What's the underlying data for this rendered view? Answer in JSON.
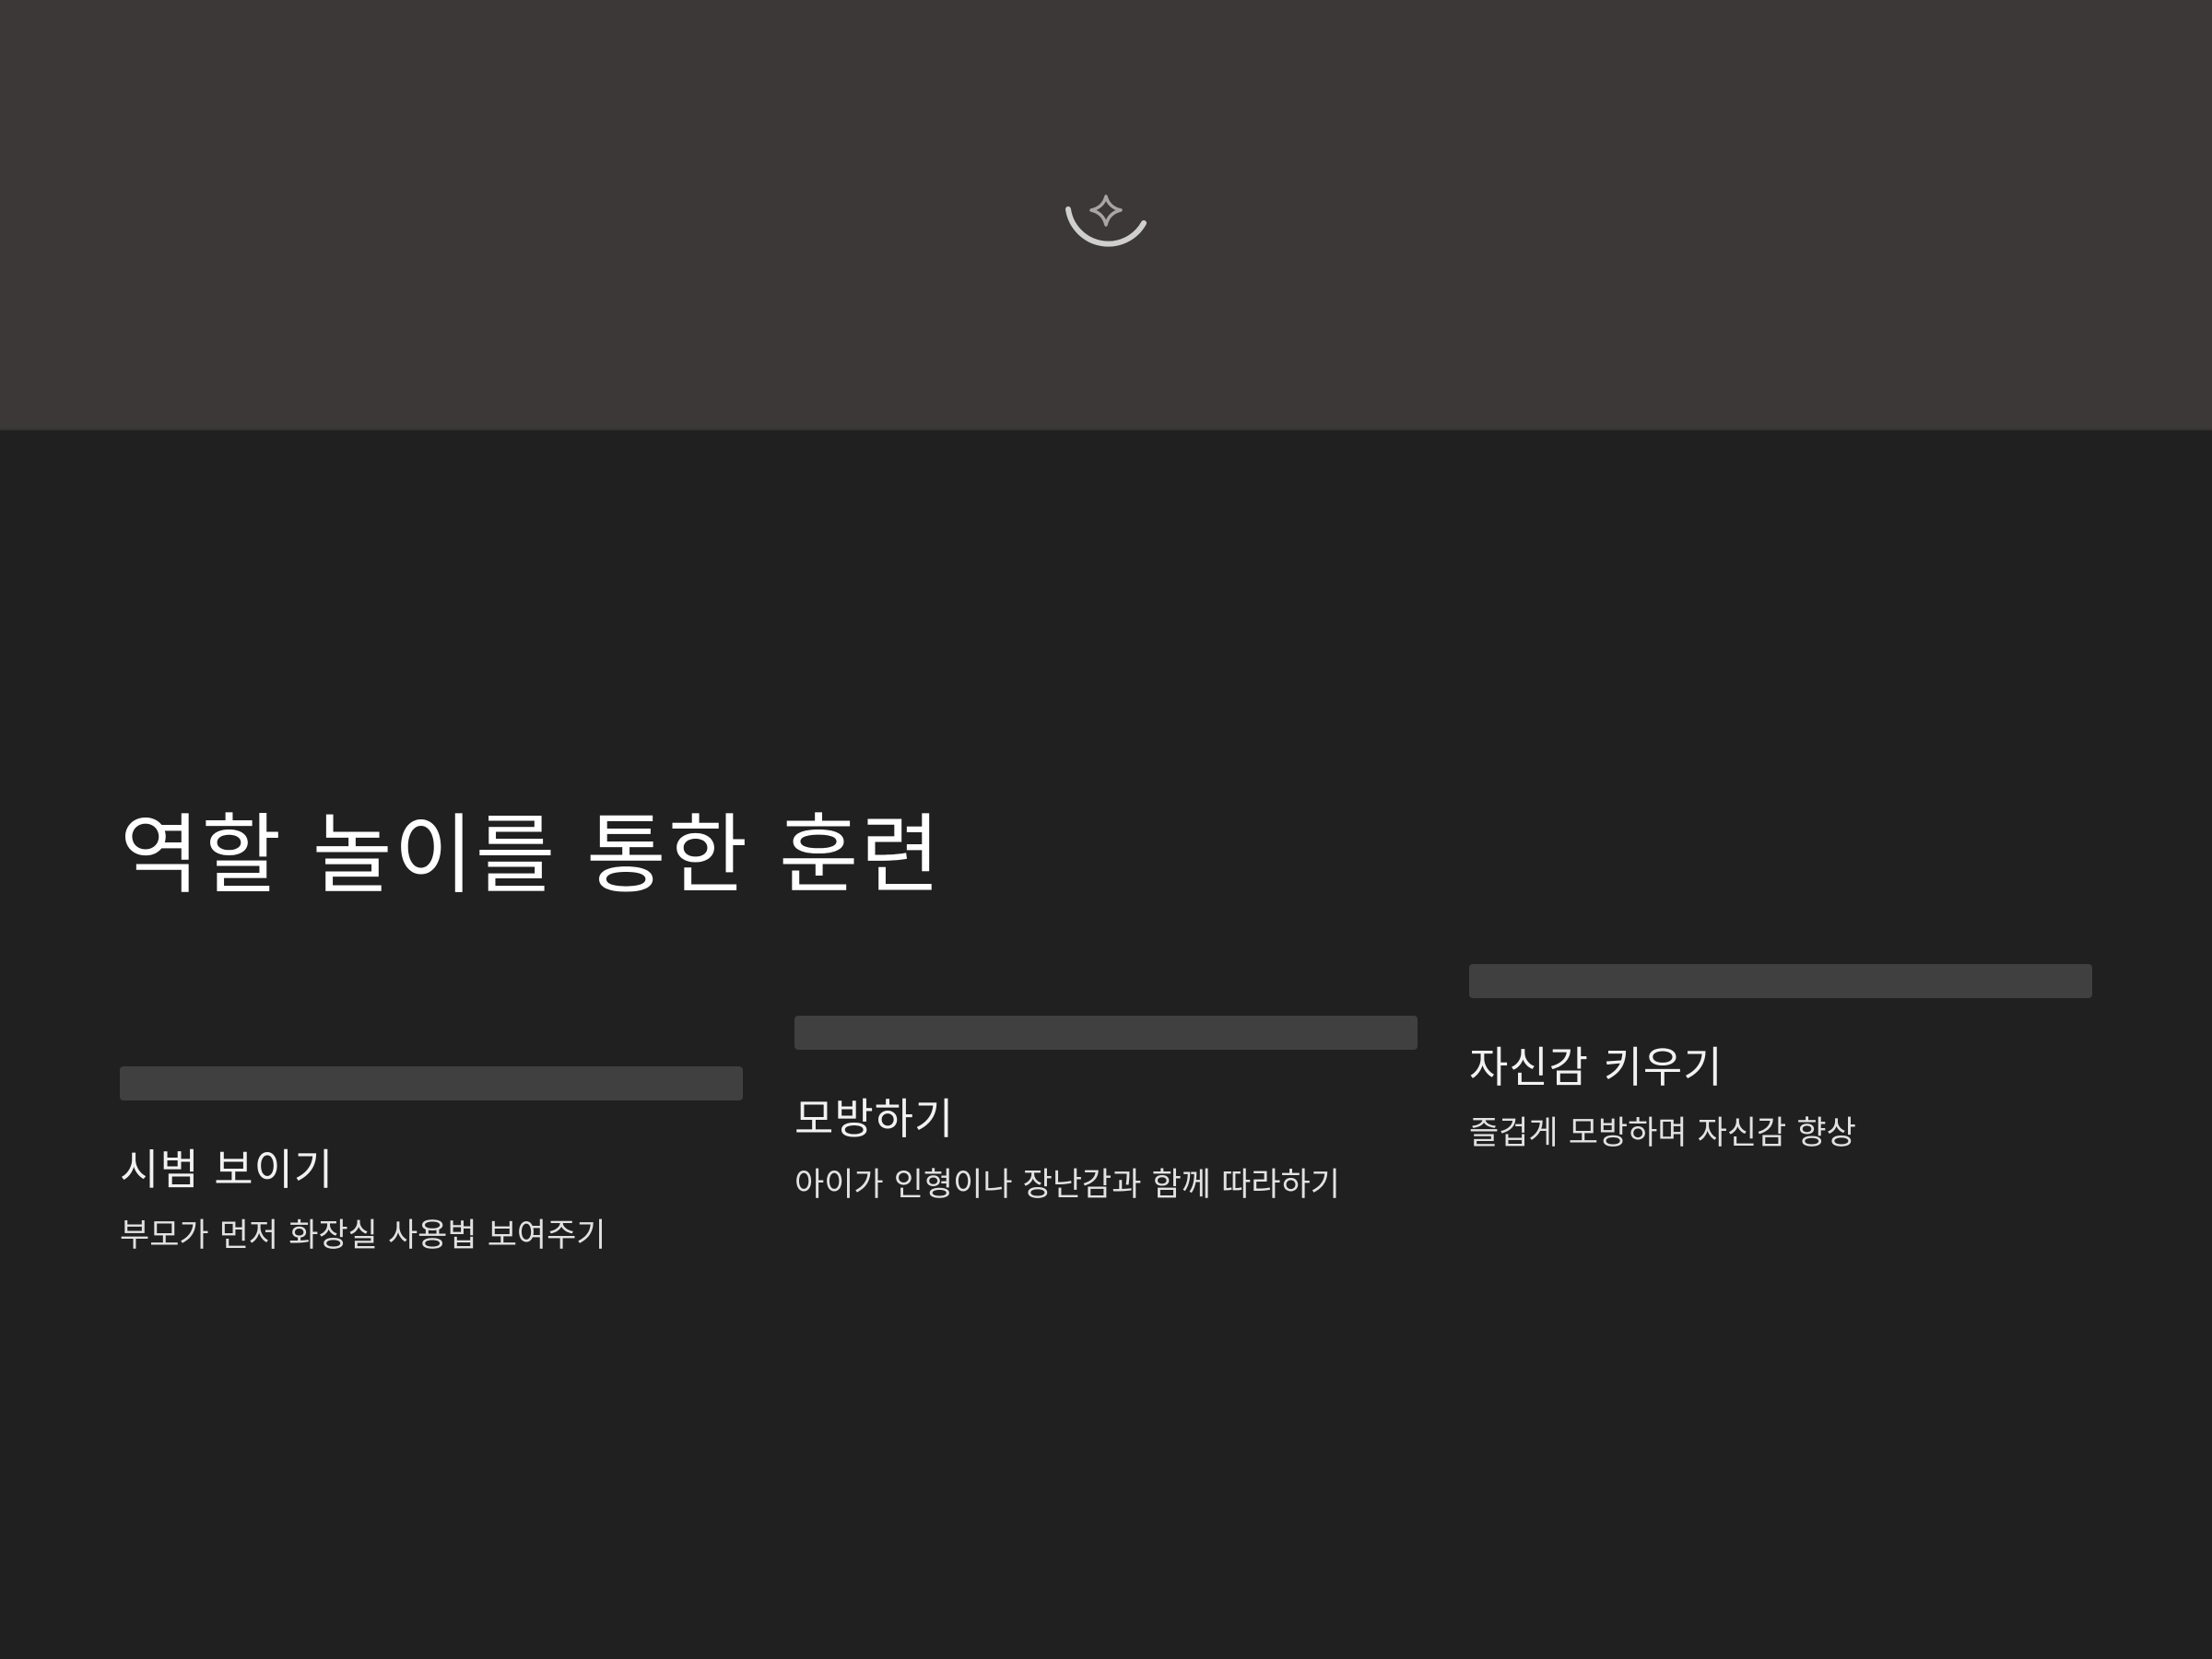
{
  "hero": {
    "icon": "sparkle-loading-icon",
    "colors": {
      "background": "#3c3838",
      "icon_stroke": "#cfcfcf"
    }
  },
  "slide": {
    "title": "역할 놀이를 통한 훈련",
    "colors": {
      "background": "#202020",
      "bar": "#404040",
      "text": "#ffffff"
    },
    "steps": [
      {
        "heading": "시범 보이기",
        "description": "부모가 먼저 화장실 사용법 보여주기"
      },
      {
        "heading": "모방하기",
        "description": "아이가 인형이나 장난감과 함께 따라하기"
      },
      {
        "heading": "자신감 키우기",
        "description": "즐겁게 모방하며 자신감 향상"
      }
    ]
  }
}
